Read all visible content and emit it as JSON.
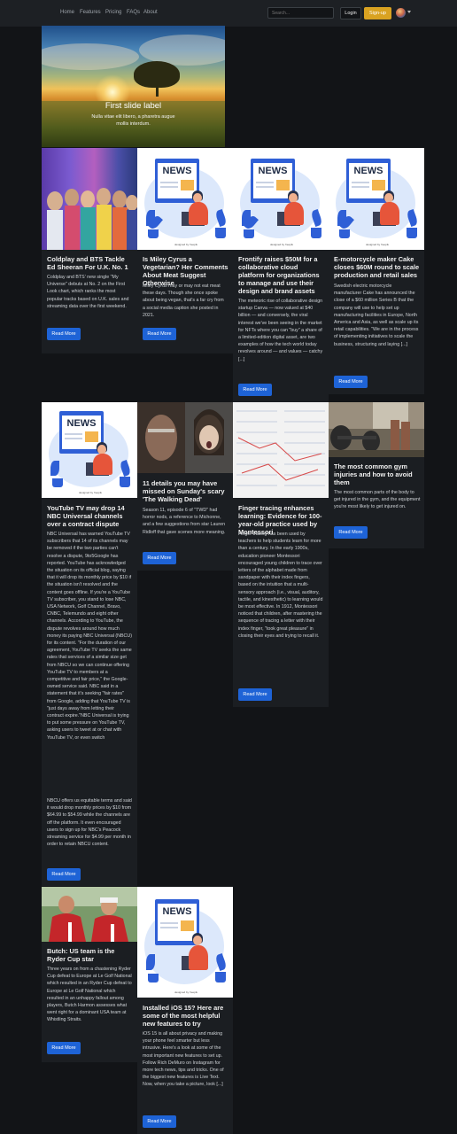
{
  "nav": {
    "links": [
      "Home",
      "Features",
      "Pricing",
      "FAQs",
      "About"
    ],
    "search_placeholder": "Search...",
    "login": "Login",
    "signup": "Sign-up"
  },
  "hero": {
    "title": "First slide label",
    "subtitle": "Nulla vitae elit libero, a pharetra augue mollis interdum."
  },
  "news_illustration": {
    "word": "NEWS",
    "credit": "designed by freepik"
  },
  "cards": [
    {
      "title": "Coldplay and BTS Tackle Ed Sheeran For U.K. No. 1",
      "text": "Coldplay and BTS' new single \"My Universe\" debuts at No. 2 on the First Look chart, which ranks the most popular tracks based on U.K. sales and streaming data over the first weekend.",
      "button": "Read More"
    },
    {
      "title": "Is Miley Cyrus a Vegetarian? Her Comments About Meat Suggest Otherwise",
      "text": "Miley Cyrus may or may not eat meat these days. Though she once spoke about being vegan, that's a far cry from a social media caption she posted in 2021.",
      "button": "Read More"
    },
    {
      "title": "Frontify raises $50M for a collaborative cloud platform for organizations to manage and use their design and brand assets",
      "text": "The meteoric rise of collaborative design startup Canva — now valued at $40 billion — and conversely, the viral interest we've been seeing in the market for NFTs where you can \"buy\" a share of a limited-edition digital asset, are two examples of how the tech world today revolves around — and values — catchy [...]",
      "button": "Read More"
    },
    {
      "title": "E-motorcycle maker Cake closes $60M round to scale production and retail sales",
      "text": "Swedish electric motorcycle manufacturer Cake has announced the close of a $60 million Series B that the company will use to help set up manufacturing facilities in Europe, North America and Asia, as well as scale up its retail capabilities. \"We are in the process of implementing initiatives to scale the business, structuring and laying [...]",
      "button": "Read More"
    },
    {
      "title": "YouTube TV may drop 14 NBC Universal channels over a contract dispute",
      "text": "NBC Universal has warned YouTube TV subscribers that 14 of its channels may be removed if the two parties can't resolve a dispute, 9to5Google has reported. YouTube has acknowledged the situation on its official blog, saying that it will drop its monthly price by $10 if the situation isn't resolved and the content goes offline. If you're a YouTube TV subscriber, you stand to lose NBC, USA Network, Golf Channel, Bravo, CNBC, Telemundo and eight other channels. According to YouTube, the dispute revolves around how much money its paying NBC Universal (NBCU) for its content. \"For the duration of our agreement, YouTube TV seeks the same rates that services of a similar size get from NBCU so we can continue offering YouTube TV to members at a competitive and fair price,\" the Google-owned service said. NBC said in a statement that it's seeking \"fair rates\" from Google, adding that YouTube TV is \"just days away from letting their contract expire.\"NBC Universal is trying to put some pressure on YouTube TV, asking users to tweet at or chat with YouTube TV, or even switch",
      "text_overflow": "NBCU offers us equitable terms and said it would drop monthly prices by $10 from $64.99 to $54.99 while the channels are off the platform. It even encouraged users to sign up for NBC's Peacock streaming service for $4.99 per month in order to retain NBCU content.",
      "button": "Read More"
    },
    {
      "title": "11 details you may have missed on Sunday's scary 'The Walking Dead'",
      "text": "Season 11, episode 6 of \"TWD\" had horror nods, a reference to Michonne, and a few suggestions from star Lauren Ridloff that gave scenes more meaning.",
      "button": "Read More"
    },
    {
      "title": "Finger tracing enhances learning: Evidence for 100-year-old practice used by Montessori",
      "text": "Finger tracing has been used by teachers to help students learn for more than a century. In the early 1900s, education pioneer Montessori encouraged young children to trace over letters of the alphabet made from sandpaper with their index fingers, based on the intuition that a multi-sensory approach (i.e., visual, auditory, tactile, and kinesthetic) to learning would be most effective. In 1912, Montessori noticed that children, after mastering the sequence of tracing a letter with their index finger, \"took great pleasure\" in closing their eyes and trying to recall it.",
      "button": "Read More"
    },
    {
      "title": "The most common gym injuries and how to avoid them",
      "text": "The most common parts of the body to get injured in the gym, and the equipment you're most likely to get injured on.",
      "button": "Read More"
    },
    {
      "title": "Butch: US team is the Ryder Cup star",
      "text": "Three years on from a chastening Ryder Cup defeat to Europe at Le Golf National which resulted in an Ryder Cup defeat to Europe at Le Golf National which resulted in an unhappy fallout among players, Butch Harmon assesses what went right for a dominant USA team at Whistling Straits.",
      "button": "Read More"
    },
    {
      "title": "Installed iOS 15? Here are some of the most helpful new features to try",
      "text": "iOS 15 is all about privacy and making your phone feel smarter but less intrusive. Here's a look at some of the most important new features to set up. Follow Rich DeMuro on Instagram for more tech news, tips and tricks. One of the biggest new features is Live Text. Now, when you take a picture, look [...]",
      "button": "Read More"
    }
  ]
}
